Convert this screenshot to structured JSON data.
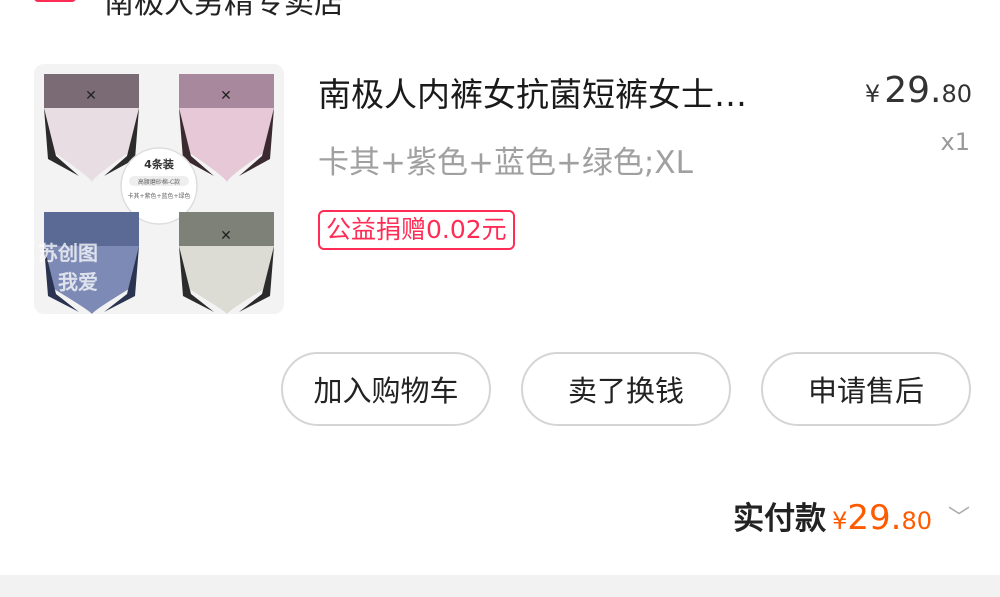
{
  "shop": {
    "name": "南极人男精专卖店",
    "icon": "shop-icon",
    "chevron": "›"
  },
  "product": {
    "title": "南极人内裤女抗菌短裤女士…",
    "price_symbol": "¥",
    "price_int": "29.",
    "price_dec": "80",
    "quantity": "x1",
    "sku": "卡其+紫色+蓝色+绿色;XL",
    "charity": "公益捐赠0.02元",
    "image": {
      "pack_label": "4条装",
      "pack_sub1": "高腰磨砂棉-C款",
      "pack_sub2": "卡其+紫色+蓝色+绿色",
      "watermark1": "苏创图",
      "watermark2": "我爱"
    }
  },
  "actions": {
    "add_to_cart": "加入购物车",
    "sell_for_cash": "卖了换钱",
    "after_sales": "申请售后"
  },
  "total": {
    "label": "实付款",
    "symbol": "¥",
    "int": "29.",
    "dec": "80",
    "chevron": "﹀"
  },
  "colors": {
    "accent_pink": "#ff2d55",
    "price_orange": "#ff5a00"
  }
}
